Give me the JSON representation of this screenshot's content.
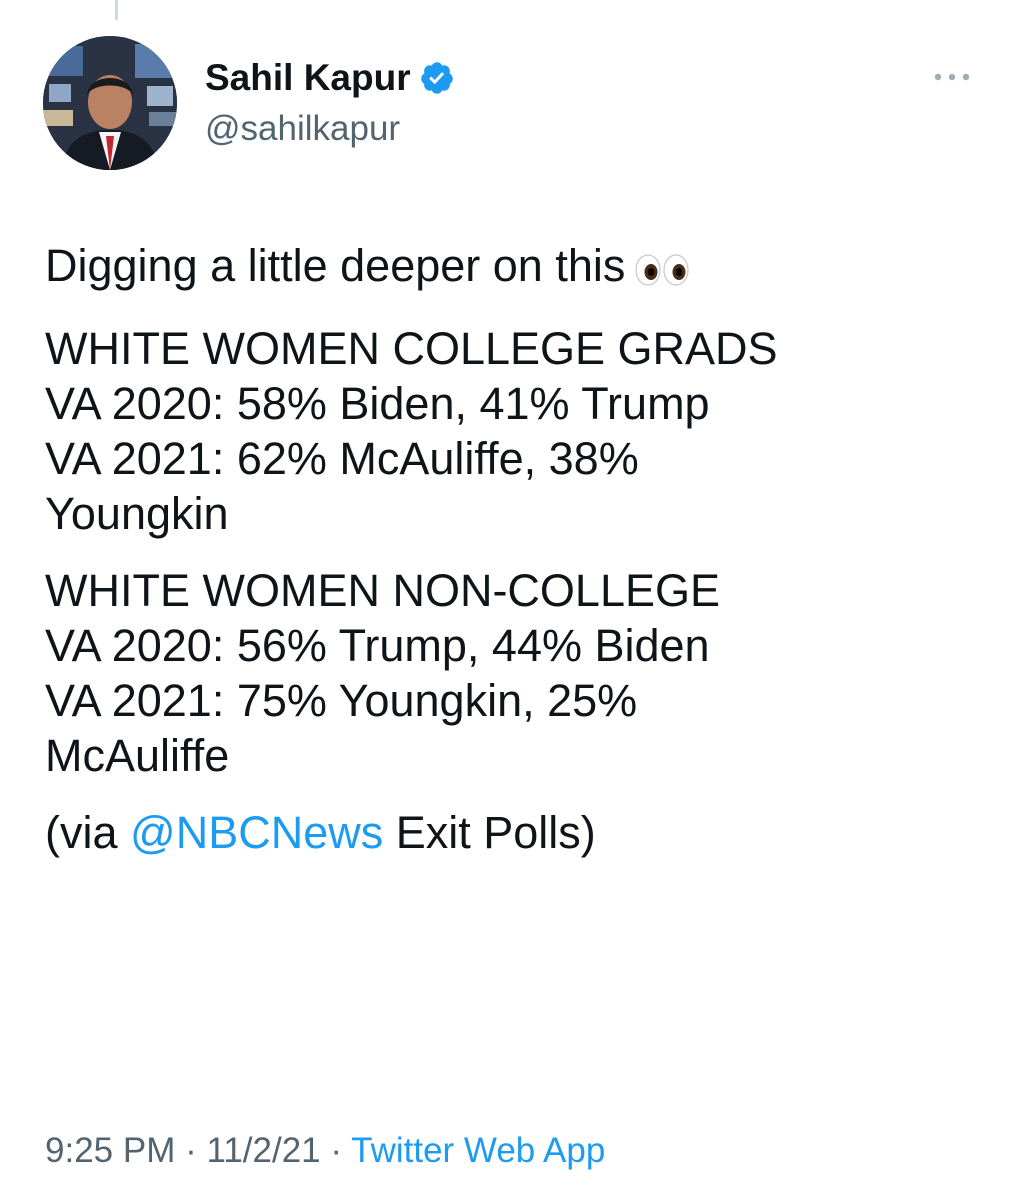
{
  "author": {
    "display_name": "Sahil Kapur",
    "handle": "@sahilkapur",
    "verified": true
  },
  "tweet": {
    "intro_text": "Digging a little deeper on this",
    "intro_emoji": "eyes-emoji",
    "block1": {
      "heading": "WHITE WOMEN COLLEGE GRADS",
      "line1": "VA 2020: 58% Biden, 41% Trump",
      "line2a": "VA 2021: 62% McAuliffe, 38%",
      "line2b": "Youngkin"
    },
    "block2": {
      "heading": "WHITE WOMEN NON-COLLEGE",
      "line1": "VA 2020: 56% Trump, 44% Biden",
      "line2a": "VA 2021: 75% Youngkin, 25%",
      "line2b": "McAuliffe"
    },
    "source_prefix": "(via ",
    "source_mention": "@NBCNews",
    "source_suffix": " Exit Polls)"
  },
  "meta": {
    "time": "9:25 PM",
    "separator": " · ",
    "date": "11/2/21",
    "client": "Twitter Web App"
  },
  "colors": {
    "link": "#1d9bf0",
    "secondary_text": "#536471",
    "primary_text": "#0f1419",
    "verified": "#1d9bf0"
  }
}
